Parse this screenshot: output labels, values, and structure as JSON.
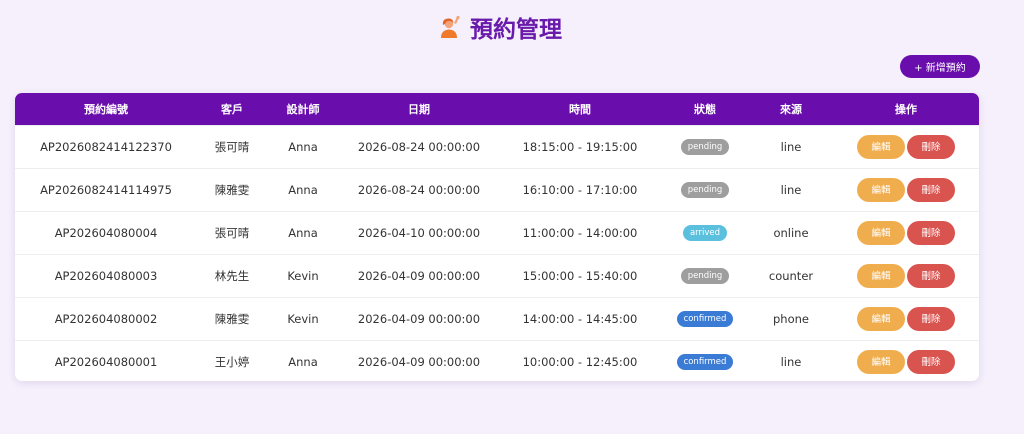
{
  "header": {
    "title": "預約管理",
    "icon": "person-raising-hand-icon"
  },
  "toolbar": {
    "add_label": "+ 新增預約"
  },
  "table": {
    "columns": [
      "預約編號",
      "客戶",
      "設計師",
      "日期",
      "時間",
      "狀態",
      "來源",
      "操作"
    ],
    "rows": [
      {
        "id": "AP2026082414122370",
        "customer": "張可晴",
        "designer": "Anna",
        "date": "2026-08-24 00:00:00",
        "time": "18:15:00 - 19:15:00",
        "status": "pending",
        "source": "line"
      },
      {
        "id": "AP2026082414114975",
        "customer": "陳雅雯",
        "designer": "Anna",
        "date": "2026-08-24 00:00:00",
        "time": "16:10:00 - 17:10:00",
        "status": "pending",
        "source": "line"
      },
      {
        "id": "AP202604080004",
        "customer": "張可晴",
        "designer": "Anna",
        "date": "2026-04-10 00:00:00",
        "time": "11:00:00 - 14:00:00",
        "status": "arrived",
        "source": "online"
      },
      {
        "id": "AP202604080003",
        "customer": "林先生",
        "designer": "Kevin",
        "date": "2026-04-09 00:00:00",
        "time": "15:00:00 - 15:40:00",
        "status": "pending",
        "source": "counter"
      },
      {
        "id": "AP202604080002",
        "customer": "陳雅雯",
        "designer": "Kevin",
        "date": "2026-04-09 00:00:00",
        "time": "14:00:00 - 14:45:00",
        "status": "confirmed",
        "source": "phone"
      },
      {
        "id": "AP202604080001",
        "customer": "王小婷",
        "designer": "Anna",
        "date": "2026-04-09 00:00:00",
        "time": "10:00:00 - 12:45:00",
        "status": "confirmed",
        "source": "line"
      }
    ],
    "actions": {
      "edit_label": "編輯",
      "delete_label": "刪除"
    }
  },
  "colors": {
    "accent": "#6a0dad",
    "status": {
      "pending": "#9e9e9e",
      "arrived": "#5bc0de",
      "confirmed": "#3a7bd5"
    },
    "edit": "#f0ad4e",
    "delete": "#d9534f"
  }
}
